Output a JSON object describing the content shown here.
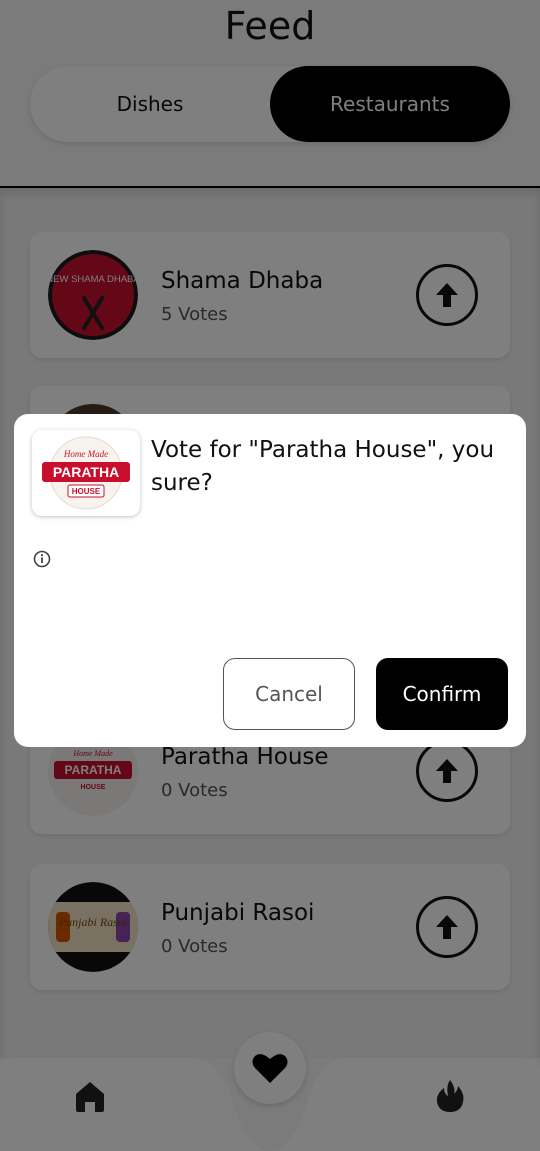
{
  "header": {
    "title": "Feed"
  },
  "tabs": [
    {
      "label": "Dishes",
      "active": false
    },
    {
      "label": "Restaurants",
      "active": true
    }
  ],
  "restaurants": [
    {
      "name": "Shama Dhaba",
      "votes": "5 Votes",
      "logo_text": "NEW SHAMA DHABA",
      "logo_icon": "fork-knife-icon"
    },
    {
      "name": "Paratha House",
      "votes": "0 Votes",
      "logo_text": "PARATHA",
      "logo_sub": "HOUSE",
      "logo_top": "Home Made"
    },
    {
      "name": "Punjabi Rasoi",
      "votes": "0 Votes",
      "logo_text": "Punjabi Rasoi"
    }
  ],
  "dialog": {
    "message": "Vote for \"Paratha House\", you sure?",
    "logo_text": "PARATHA",
    "logo_sub": "HOUSE",
    "logo_top": "Home Made",
    "cancel_label": "Cancel",
    "confirm_label": "Confirm",
    "info_icon": "info-icon"
  },
  "nav": {
    "left_icon": "home-icon",
    "center_icon": "heart-icon",
    "right_icon": "fire-icon"
  },
  "colors": {
    "accent": "#000000",
    "brand_red": "#c8102e"
  }
}
